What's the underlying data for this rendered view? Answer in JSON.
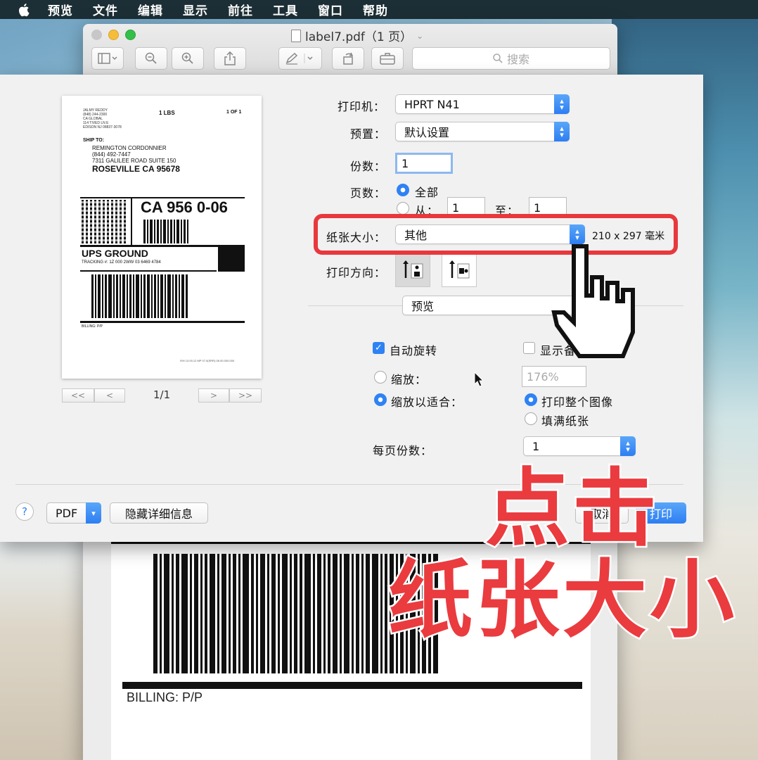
{
  "menubar": {
    "items": [
      "预览",
      "文件",
      "编辑",
      "显示",
      "前往",
      "工具",
      "窗口",
      "帮助"
    ]
  },
  "window": {
    "title": "label7.pdf（1 页）",
    "search_placeholder": "搜索"
  },
  "document_behind": {
    "billing": "BILLING: P/P"
  },
  "label_preview": {
    "weight": "1 LBS",
    "count": "1 OF 1",
    "sender_lines": [
      "JALMY REDDY",
      "(848) 244-2300",
      "CA GLOBAL",
      "114 TIVED LN E",
      "EDISON NJ 08837-3078"
    ],
    "ship_to_label": "SHIP TO:",
    "recipient_name": "REMINGTON CORDONNIER",
    "recipient_phone": "(844) 492-7447",
    "recipient_street": "7311 GALILEE ROAD SUITE 150",
    "recipient_city": "ROSEVILLE  CA 95678",
    "route_code": "CA 956 0-06",
    "service": "UPS GROUND",
    "tracking": "TRACKING #: 1Z 000 2WW 03 6469 4784",
    "billing": "BILLING: P/P",
    "footer": "ISH 13.00.12 MP 07.0(SRR) 06.00.000.000"
  },
  "pager": {
    "first": "<<",
    "prev": "<",
    "next": ">",
    "last": ">>",
    "indicator": "1/1"
  },
  "print_form": {
    "printer_label": "打印机：",
    "printer_value": "HPRT N41",
    "preset_label": "预置：",
    "preset_value": "默认设置",
    "copies_label": "份数：",
    "copies_value": "1",
    "pages_label": "页数：",
    "pages_all": "全部",
    "pages_from": "从：",
    "pages_from_value": "1",
    "pages_to": "至：",
    "pages_to_value": "1",
    "paper_size_label": "纸张大小：",
    "paper_size_value": "其他",
    "paper_dimensions": "210 x 297 毫米",
    "orientation_label": "打印方向：",
    "section_value": "预览",
    "auto_rotate": "自动旋转",
    "show_notes": "显示备注",
    "scale_label": "缩放：",
    "scale_value": "176%",
    "scale_to_fit": "缩放以适合：",
    "print_entire_image": "打印整个图像",
    "fill_paper": "填满纸张",
    "copies_per_page_label": "每页份数：",
    "copies_per_page_value": "1"
  },
  "footer_buttons": {
    "help": "?",
    "pdf": "PDF",
    "hide_details": "隐藏详细信息",
    "cancel": "取消",
    "print": "打印"
  },
  "overlay": {
    "line1": "点击",
    "line2": "纸张大小"
  },
  "colors": {
    "accent_blue": "#2f82f3",
    "annotation_red": "#e8383d",
    "menubar_bg": "#1d2f36"
  }
}
